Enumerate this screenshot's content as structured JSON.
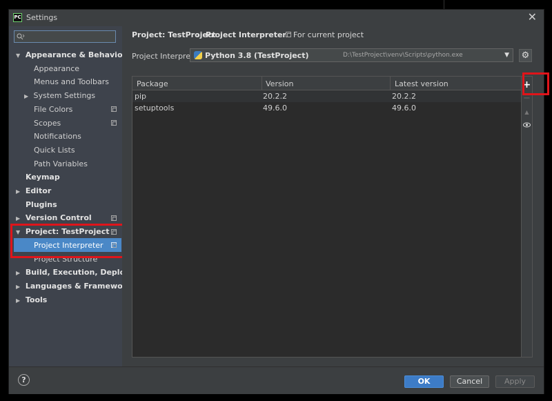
{
  "window": {
    "title": "Settings",
    "close_label": "✕",
    "app_icon_text": "PC"
  },
  "search": {
    "placeholder": ""
  },
  "sidebar": {
    "items": [
      {
        "label": "Appearance & Behavior"
      },
      {
        "label": "Appearance"
      },
      {
        "label": "Menus and Toolbars"
      },
      {
        "label": "System Settings"
      },
      {
        "label": "File Colors"
      },
      {
        "label": "Scopes"
      },
      {
        "label": "Notifications"
      },
      {
        "label": "Quick Lists"
      },
      {
        "label": "Path Variables"
      },
      {
        "label": "Keymap"
      },
      {
        "label": "Editor"
      },
      {
        "label": "Plugins"
      },
      {
        "label": "Version Control"
      },
      {
        "label": "Project: TestProject"
      },
      {
        "label": "Project Interpreter"
      },
      {
        "label": "Project Structure"
      },
      {
        "label": "Build, Execution, Deployment"
      },
      {
        "label": "Languages & Frameworks"
      },
      {
        "label": "Tools"
      }
    ]
  },
  "breadcrumb": {
    "project": "Project: TestProject",
    "separator": "›",
    "page": "Project Interpreter",
    "scope": "For current project"
  },
  "interpreter": {
    "label": "Project Interpreter:",
    "name": "Python 3.8 (TestProject)",
    "path": "D:\\TestProject\\venv\\Scripts\\python.exe"
  },
  "table": {
    "headers": [
      "Package",
      "Version",
      "Latest version"
    ],
    "rows": [
      [
        "pip",
        "20.2.2",
        "20.2.2"
      ],
      [
        "setuptools",
        "49.6.0",
        "49.6.0"
      ]
    ]
  },
  "tools": {
    "add": "+",
    "remove": "−",
    "upgrade": "▲",
    "show_early": "👁"
  },
  "footer": {
    "help": "?",
    "ok": "OK",
    "cancel": "Cancel",
    "apply": "Apply"
  },
  "colors": {
    "highlight": "#e0141a",
    "selection": "#4a88c7",
    "ok_button": "#3d7cc7"
  }
}
